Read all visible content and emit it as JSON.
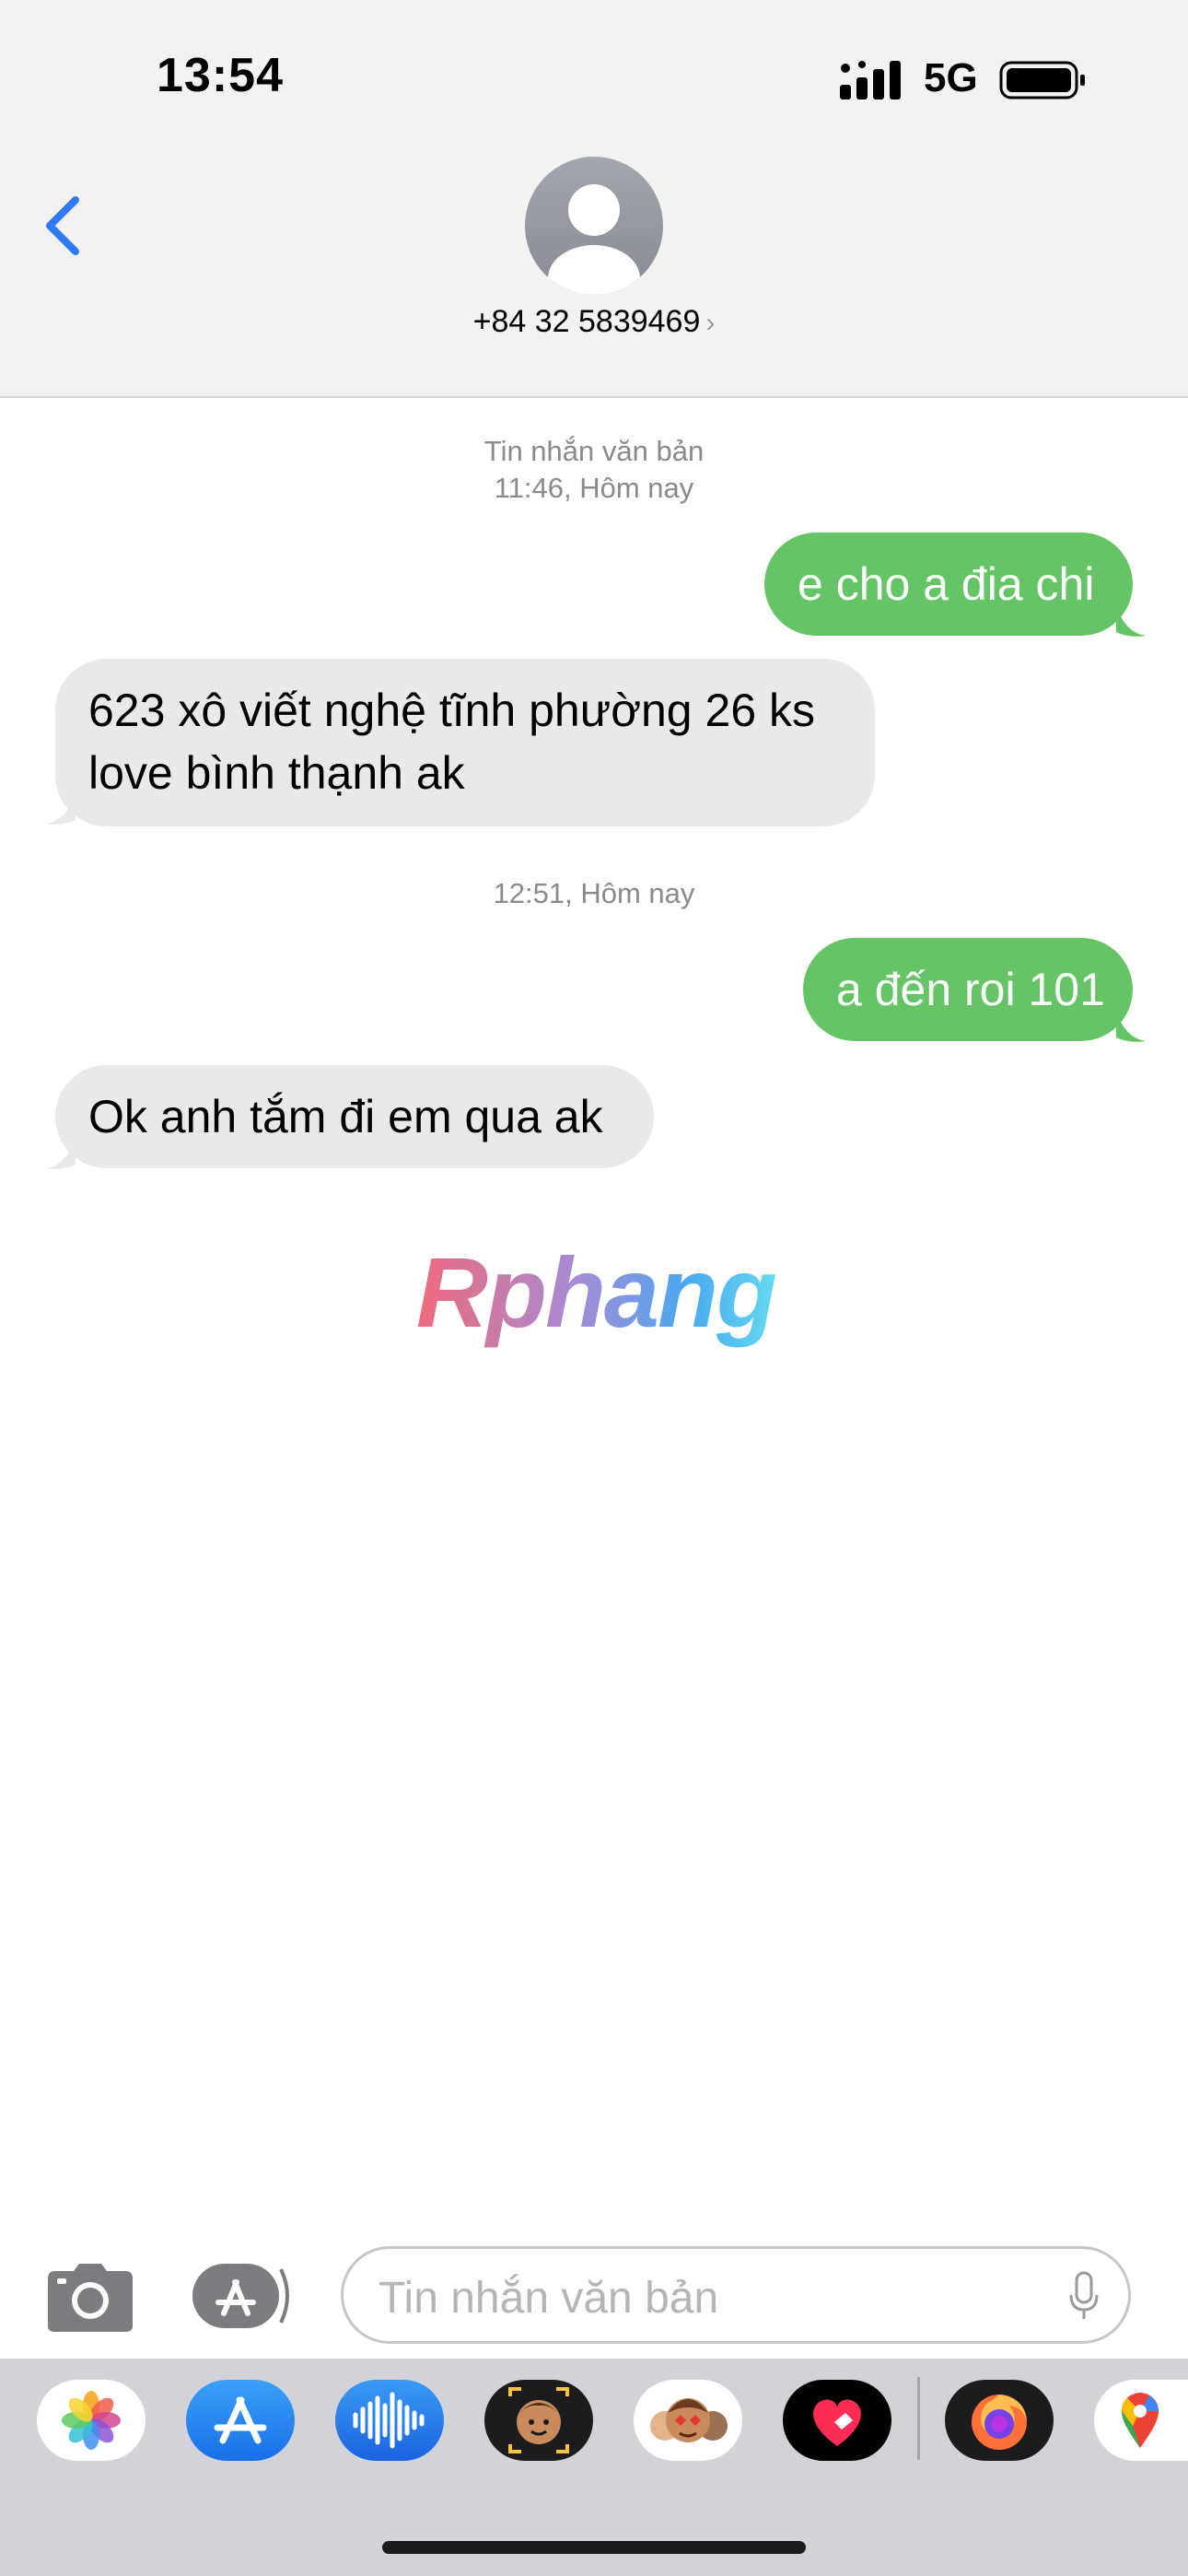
{
  "status_bar": {
    "time": "13:54",
    "network": "5G"
  },
  "contact": {
    "number": "+84 32 5839469"
  },
  "conversation": {
    "header1": {
      "service": "Tin nhắn văn bản",
      "time": "11:46, Hôm nay"
    },
    "msg1": "e cho a đia chi",
    "msg2": {
      "line1": "623 xô viết nghệ tĩnh phường 26 ks",
      "line2": "love bình thạnh ak"
    },
    "header2": {
      "time": "12:51, Hôm nay"
    },
    "msg3": "a đến roi 101",
    "msg4": "Ok anh tắm đi em qua ak"
  },
  "watermark": "Rphang",
  "input": {
    "placeholder": "Tin nhắn văn bản"
  },
  "app_drawer": [
    "photos",
    "app-store",
    "audio-message",
    "memoji-camera",
    "memoji-stickers",
    "digital-touch",
    "firefox",
    "google-maps"
  ],
  "colors": {
    "outgoing": "#65c466",
    "incoming": "#e9e9eb",
    "accent": "#2f7bf6"
  }
}
